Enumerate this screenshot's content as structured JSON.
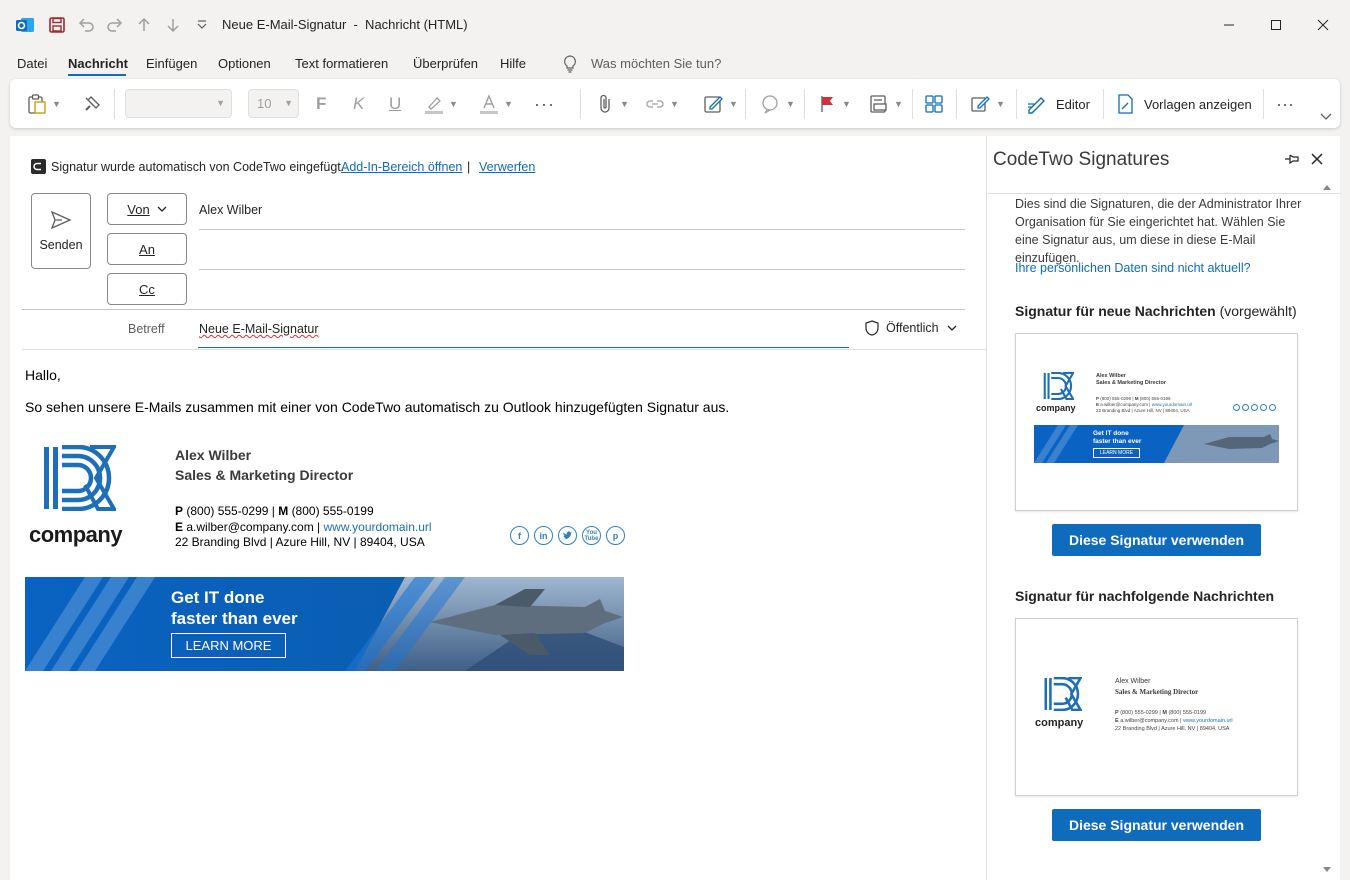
{
  "window": {
    "title": "Neue E-Mail-Signatur  -  Nachricht (HTML)"
  },
  "menu": {
    "items": [
      "Datei",
      "Nachricht",
      "Einfügen",
      "Optionen",
      "Text formatieren",
      "Überprüfen",
      "Hilfe"
    ],
    "active": "Nachricht",
    "tell_me": "Was möchten Sie tun?"
  },
  "ribbon": {
    "font_size": "10",
    "editor_label": "Editor",
    "templates_label": "Vorlagen anzeigen"
  },
  "infobar": {
    "text": "Signatur wurde automatisch von CodeTwo eingefügt.",
    "open_link": "Add-In-Bereich öffnen",
    "separator": "|",
    "discard_link": "Verwerfen"
  },
  "header": {
    "send_label": "Senden",
    "from_label": "Von",
    "from_value": "Alex Wilber",
    "to_label": "An",
    "cc_label": "Cc",
    "subject_label": "Betreff",
    "subject_value": "Neue E-Mail-Signatur",
    "sensitivity": "Öffentlich"
  },
  "body": {
    "greeting": "Hallo,",
    "paragraph": "So sehen unsere E-Mails zusammen mit einer von CodeTwo automatisch zu Outlook hinzugefügten Signatur aus."
  },
  "signature": {
    "company": "company",
    "name": "Alex Wilber",
    "title": "Sales & Marketing Director",
    "phone_label": "P",
    "phone": "(800) 555-0299",
    "mobile_label": "M",
    "mobile": "(800) 555-0199",
    "email_label": "E",
    "email": "a.wilber@company.com",
    "website": "www.yourdomain.url",
    "address": "22 Branding Blvd | Azure Hill, NV | 89404, USA",
    "social_icons": [
      "facebook-icon",
      "linkedin-icon",
      "twitter-icon",
      "youtube-icon",
      "pinterest-icon"
    ],
    "youtube_text": "You Tube",
    "banner_line1": "Get IT done",
    "banner_line2": "faster than ever",
    "banner_button": "LEARN MORE"
  },
  "pane": {
    "title": "CodeTwo Signatures",
    "intro": "Dies sind die Signaturen, die der Administrator Ihrer Organisation für Sie eingerichtet hat. Wählen Sie eine Signatur aus, um diese in diese E-Mail einzufügen.",
    "data_link": "Ihre persönlichen Daten sind nicht aktuell?",
    "new_heading": "Signatur für neue Nachrichten",
    "new_heading_suffix": "(vorgewählt)",
    "reply_heading": "Signatur für nachfolgende Nachrichten",
    "use_button": "Diese Signatur verwenden"
  },
  "colors": {
    "accent": "#0f6cbd",
    "brand_blue": "#1e6fb8",
    "outlook_blue": "#0078d4"
  }
}
